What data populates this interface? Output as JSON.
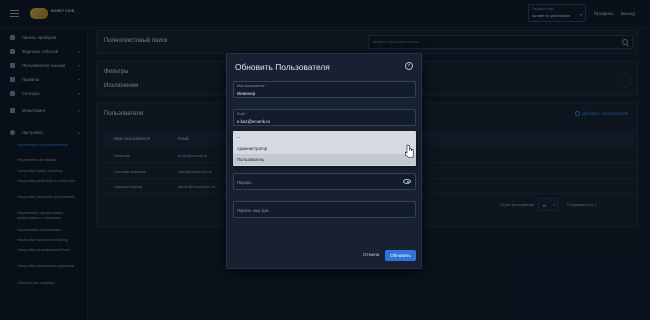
{
  "topbar": {
    "logo_text": "HONEY COIN",
    "select_label": "Текущий отчет",
    "select_value": "Активе по умолчанию",
    "profile_link": "Профиль",
    "logout_link": "Выход"
  },
  "sidebar": {
    "items": [
      {
        "label": "Панель приборов"
      },
      {
        "label": "Журналы событий"
      },
      {
        "label": "Пользователи заказов"
      },
      {
        "label": "Правила"
      },
      {
        "label": "Сенсоры"
      },
      {
        "label": "Мониторинг"
      },
      {
        "label": "Настройки"
      }
    ],
    "sub_items": [
      {
        "label": "Управление пользователями",
        "active": true
      },
      {
        "label": "Управление активами"
      },
      {
        "label": "Настройки Active directory"
      },
      {
        "label": "Настройка действий по событию"
      },
      {
        "label": "Настройки политики требований"
      },
      {
        "label": "Управление параметрами мониторинга и принципа"
      },
      {
        "label": "Управление лицензиями"
      },
      {
        "label": "Настройка экспорта в Syslog"
      },
      {
        "label": "Настройки отправления Email"
      },
      {
        "label": "Настройки системных журналов"
      },
      {
        "label": "Обновление сервера"
      }
    ]
  },
  "main": {
    "fulltext_title": "Полнотекстовый поиск",
    "search_placeholder": "Введите фразу для поиска...",
    "filters_title": "Фильтры",
    "exclusions_title": "Исключения",
    "users_title": "Пользователи",
    "add_user_label": "Добавить пользователя",
    "table": {
      "headers": [
        "Имя пользователя",
        "Email"
      ],
      "rows": [
        {
          "name": "Инженер",
          "email": "e.kaz@ecomk.ru"
        },
        {
          "name": "Сетевой инженер",
          "email": "user@honeycom.ru"
        },
        {
          "name": "Администратор",
          "email": "admin@honeycom.ru"
        }
      ]
    },
    "rows_per_page_label": "Строк на странице:",
    "rows_per_page_value": "10",
    "page_info": "Страница 1 из 1"
  },
  "modal": {
    "title": "Обновить Пользователя",
    "username_label": "Имя пользователя *",
    "username_value": "Инженер",
    "email_label": "Email *",
    "email_value": "e.kaz@ecomk.ru",
    "role_options": [
      "--",
      "Администратор",
      "Пользователь"
    ],
    "password_placeholder": "Пароль",
    "password_repeat_placeholder": "Пароль еще раз",
    "cancel_label": "Отмена",
    "save_label": "Обновить"
  },
  "colors": {
    "accent": "#2f74d8",
    "link": "#3f86e8",
    "background": "#111a29"
  }
}
